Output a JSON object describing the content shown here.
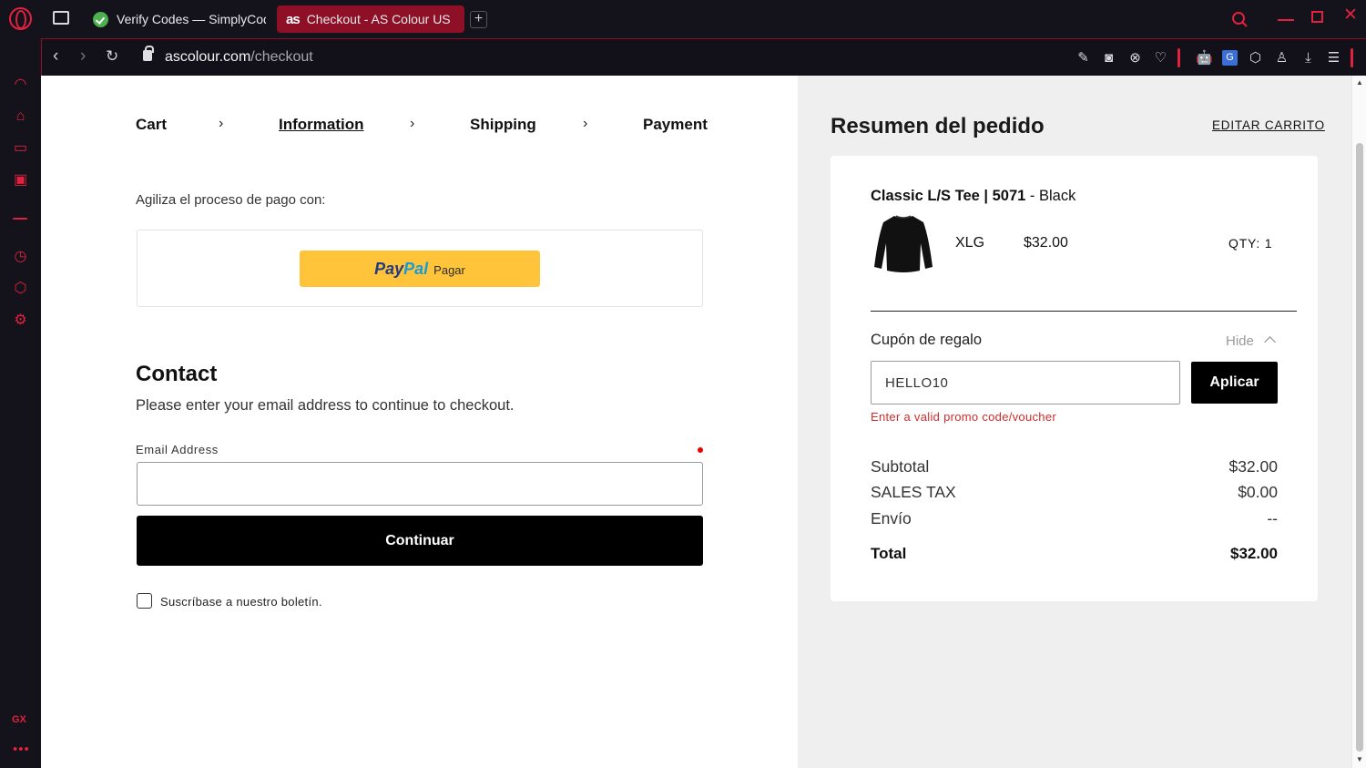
{
  "browser": {
    "tabs": [
      {
        "label": "Verify Codes — SimplyCodes",
        "active": false
      },
      {
        "label": "Checkout - AS Colour US",
        "favicon_text": "as",
        "active": true
      }
    ],
    "new_tab_label": "+",
    "url_host": "ascolour.com",
    "url_path": "/checkout",
    "accent_color": "#e0213f",
    "sidebar_bottom_label": "GX"
  },
  "checkout": {
    "breadcrumb": [
      {
        "label": "Cart",
        "active": false
      },
      {
        "label": "Information",
        "active": true
      },
      {
        "label": "Shipping",
        "active": false
      },
      {
        "label": "Payment",
        "active": false
      }
    ],
    "express_label": "Agiliza el proceso de pago con:",
    "paypal": {
      "brand_pay": "Pay",
      "brand_pal": "Pal",
      "button_text": "Pagar"
    },
    "contact_title": "Contact",
    "contact_subtitle": "Please enter your email address to continue to checkout.",
    "email_label": "Email Address",
    "email_value": "",
    "continue_label": "Continuar",
    "newsletter_label": "Suscríbase a nuestro boletín.",
    "newsletter_checked": false
  },
  "summary": {
    "title": "Resumen del pedido",
    "edit_cart": "EDITAR CARRITO",
    "product": {
      "name": "Classic L/S Tee | 5071",
      "color": " - Black",
      "size": "XLG",
      "price": "$32.00",
      "qty": "QTY: 1"
    },
    "coupon": {
      "label": "Cupón de regalo",
      "toggle": "Hide",
      "value": "HELLO10",
      "apply": "Aplicar",
      "error": "Enter a valid promo code/voucher"
    },
    "rows": [
      {
        "label": "Subtotal",
        "value": "$32.00"
      },
      {
        "label": "SALES TAX",
        "value": "$0.00"
      },
      {
        "label": "Envío",
        "value": "--"
      }
    ],
    "total_label": "Total",
    "total_value": "$32.00"
  }
}
